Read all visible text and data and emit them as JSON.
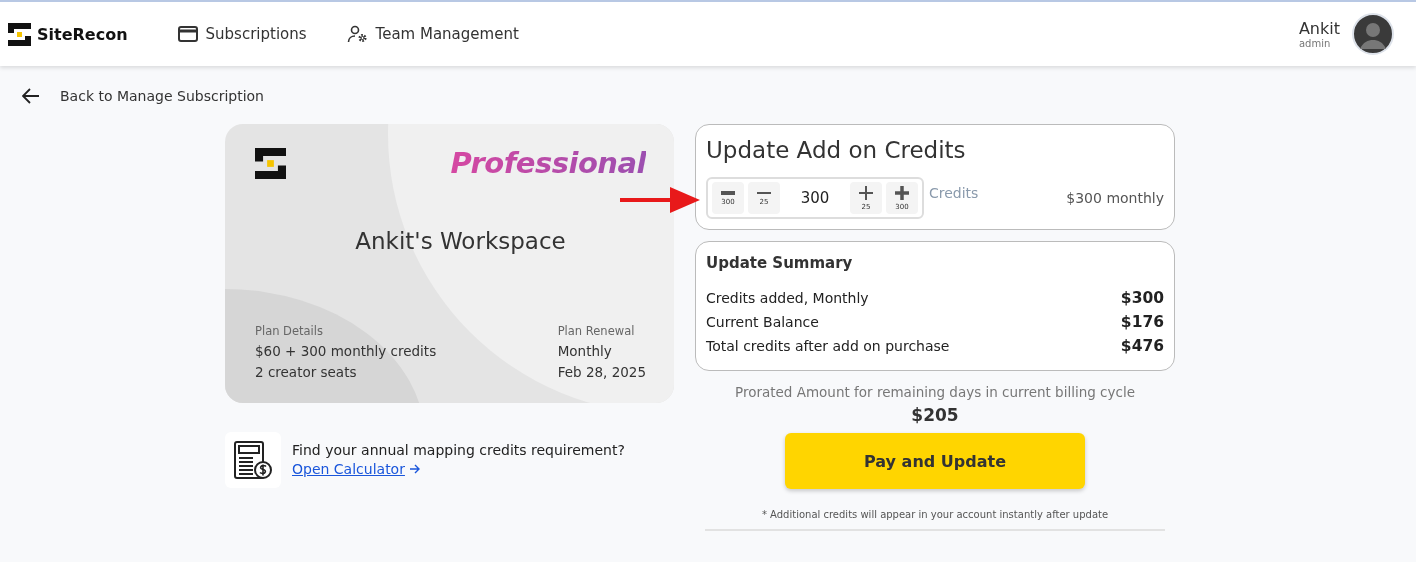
{
  "header": {
    "logo_text": "SiteRecon",
    "nav": [
      {
        "label": "Subscriptions"
      },
      {
        "label": "Team Management"
      }
    ],
    "user": {
      "name": "Ankit",
      "role": "admin"
    }
  },
  "back_link": "Back to Manage Subscription",
  "plan_card": {
    "tier": "Professional",
    "workspace": "Ankit's Workspace",
    "details_label": "Plan Details",
    "details": [
      "$60 + 300 monthly credits",
      "2 creator seats"
    ],
    "renewal_label": "Plan Renewal",
    "renewal": [
      "Monthly",
      "Feb 28, 2025"
    ]
  },
  "calculator": {
    "prompt": "Find your annual mapping credits requirement?",
    "link": "Open Calculator"
  },
  "credits": {
    "title": "Update Add on Credits",
    "steppers_before": [
      {
        "kind": "decrement",
        "heavy": true,
        "step": "300"
      },
      {
        "kind": "decrement",
        "heavy": false,
        "step": "25"
      }
    ],
    "value": "300",
    "steppers_after": [
      {
        "kind": "increment",
        "heavy": false,
        "step": "25"
      },
      {
        "kind": "increment",
        "heavy": true,
        "step": "300"
      }
    ],
    "unit": "Credits",
    "price": "$300 monthly"
  },
  "summary": {
    "title": "Update Summary",
    "rows": [
      {
        "label": "Credits added, Monthly",
        "value": "$300"
      },
      {
        "label": "Current Balance",
        "value": "$176"
      },
      {
        "label": "Total credits after add on purchase",
        "value": "$476"
      }
    ]
  },
  "prorated": {
    "label": "Prorated Amount for remaining days in current billing cycle",
    "amount": "$205"
  },
  "pay_button": "Pay and Update",
  "footnote": "* Additional credits will appear in your account instantly after update"
}
